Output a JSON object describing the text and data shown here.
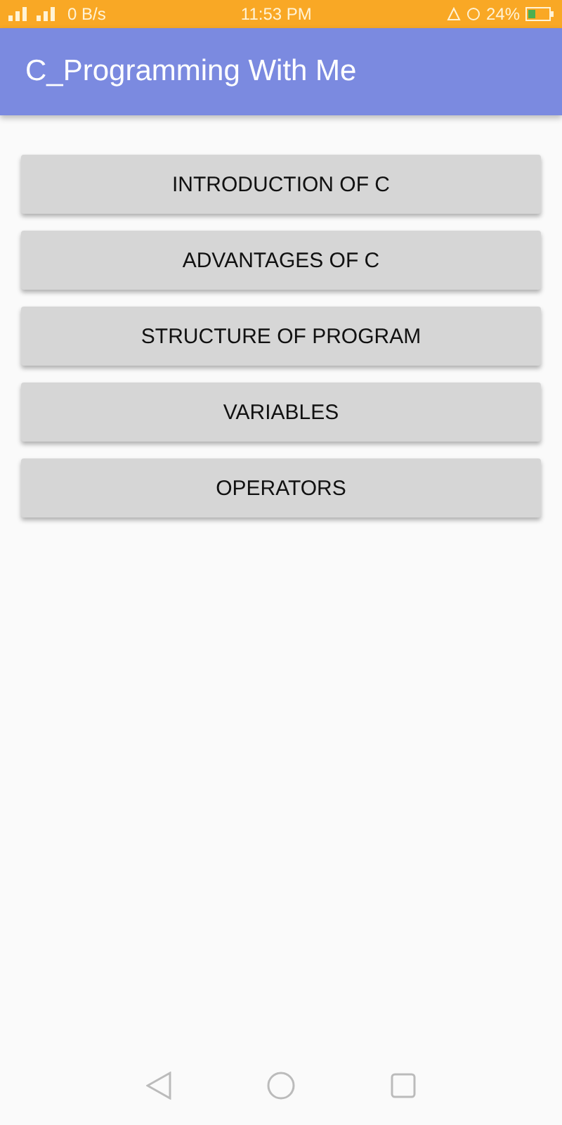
{
  "status_bar": {
    "speed": "0 B/s",
    "time": "11:53 PM",
    "battery": "24%"
  },
  "app_bar": {
    "title": "C_Programming With Me"
  },
  "buttons": [
    "INTRODUCTION OF C",
    "ADVANTAGES OF C",
    "STRUCTURE OF PROGRAM",
    "VARIABLES",
    "OPERATORS"
  ]
}
